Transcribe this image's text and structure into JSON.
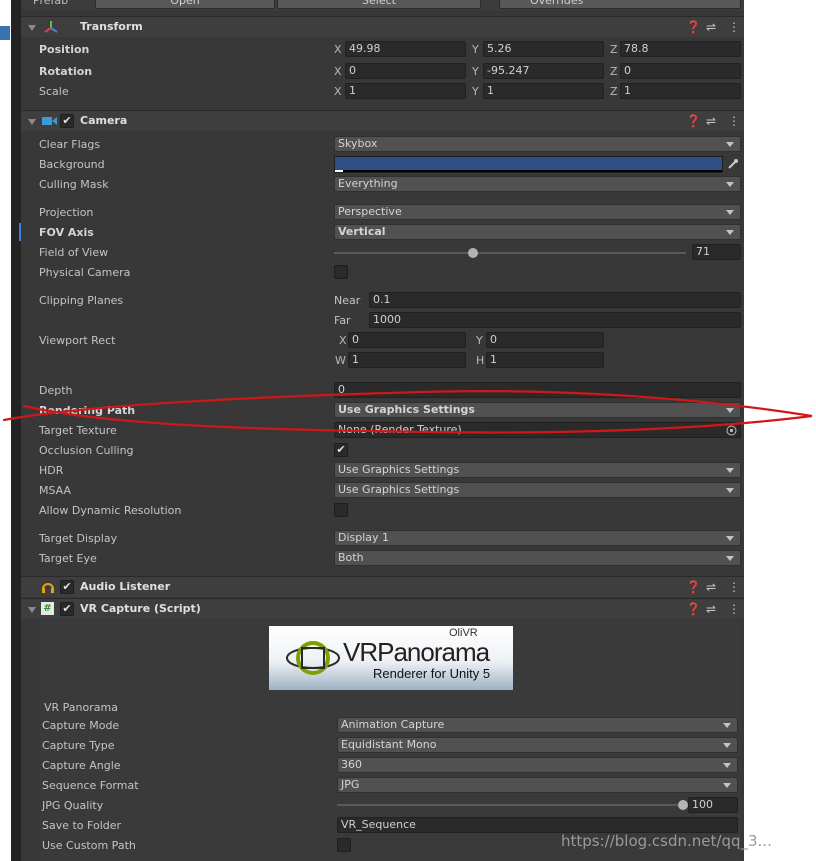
{
  "prefab_bar": {
    "open_label": "Open",
    "select_label": "Select",
    "overrides_label": "Overrides",
    "prefab_label": "Prefab"
  },
  "transform": {
    "title": "Transform",
    "position": {
      "label": "Position",
      "x": "49.98",
      "y": "5.26",
      "z": "78.8"
    },
    "rotation": {
      "label": "Rotation",
      "x": "0",
      "y": "-95.247",
      "z": "0"
    },
    "scale": {
      "label": "Scale",
      "x": "1",
      "y": "1",
      "z": "1"
    }
  },
  "axes": {
    "x": "X",
    "y": "Y",
    "z": "Z",
    "w": "W",
    "h": "H"
  },
  "camera": {
    "title": "Camera",
    "clear_flags": {
      "label": "Clear Flags",
      "value": "Skybox"
    },
    "background": {
      "label": "Background",
      "color": "#2f4e84"
    },
    "culling_mask": {
      "label": "Culling Mask",
      "value": "Everything"
    },
    "projection": {
      "label": "Projection",
      "value": "Perspective"
    },
    "fov_axis": {
      "label": "FOV Axis",
      "value": "Vertical"
    },
    "field_of_view": {
      "label": "Field of View",
      "value": "71",
      "fraction": 0.395
    },
    "physical_camera": {
      "label": "Physical Camera",
      "checked": false
    },
    "clipping_planes": {
      "label": "Clipping Planes",
      "near_label": "Near",
      "near": "0.1",
      "far_label": "Far",
      "far": "1000"
    },
    "viewport_rect": {
      "label": "Viewport Rect",
      "x": "0",
      "y": "0",
      "w": "1",
      "h": "1"
    },
    "depth": {
      "label": "Depth",
      "value": "0"
    },
    "rendering_path": {
      "label": "Rendering Path",
      "value": "Use Graphics Settings"
    },
    "target_texture": {
      "label": "Target Texture",
      "value": "None (Render Texture)"
    },
    "occlusion_culling": {
      "label": "Occlusion Culling",
      "checkmark": "✔"
    },
    "hdr": {
      "label": "HDR",
      "value": "Use Graphics Settings"
    },
    "msaa": {
      "label": "MSAA",
      "value": "Use Graphics Settings"
    },
    "allow_dynamic_resolution": {
      "label": "Allow Dynamic Resolution",
      "checked": false
    },
    "target_display": {
      "label": "Target Display",
      "value": "Display 1"
    },
    "target_eye": {
      "label": "Target Eye",
      "value": "Both"
    }
  },
  "audio_listener": {
    "title": "Audio Listener"
  },
  "vr_capture": {
    "title": "VR Capture (Script)",
    "banner": {
      "brand": "VRPanorama",
      "subtitle": "Renderer for Unity 5",
      "logo_text": "OliVR"
    },
    "section_label": "VR Panorama",
    "capture_mode": {
      "label": "Capture Mode",
      "value": "Animation Capture"
    },
    "capture_type": {
      "label": "Capture Type",
      "value": "Equidistant Mono"
    },
    "capture_angle": {
      "label": "Capture Angle",
      "value": "360"
    },
    "sequence_format": {
      "label": "Sequence Format",
      "value": "JPG"
    },
    "jpg_quality": {
      "label": "JPG Quality",
      "value": "100",
      "fraction": 1.0
    },
    "save_to_folder": {
      "label": "Save to Folder",
      "value": "VR_Sequence"
    },
    "use_custom_path": {
      "label": "Use Custom Path",
      "checked": false
    }
  },
  "header_icons": {
    "help": "❓",
    "presets": "⇌",
    "menu": "⋮",
    "checkmark": "✔"
  },
  "watermark": "https://blog.csdn.net/qq_3...",
  "annotation": {
    "color": "#d01818"
  },
  "colors": {
    "panel": "#383838",
    "field": "#2a2a2a",
    "dropdown": "#515151",
    "selection": "#3d82d6"
  }
}
